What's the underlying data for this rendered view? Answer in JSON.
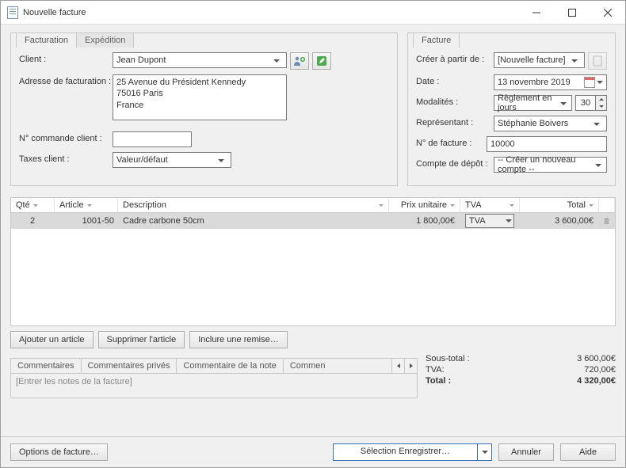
{
  "window": {
    "title": "Nouvelle facture"
  },
  "tabs_left": {
    "billing": "Facturation",
    "shipping": "Expédition"
  },
  "client": {
    "label": "Client :",
    "value": "Jean Dupont",
    "addr_label": "Adresse de facturation :",
    "addr_value": "25 Avenue du Président Kennedy\n75016 Paris\nFrance",
    "order_no_label": "N° commande client :",
    "order_no_value": "",
    "tax_label": "Taxes client :",
    "tax_value": "Valeur/défaut"
  },
  "tabs_right": {
    "invoice": "Facture"
  },
  "invoice": {
    "create_from_label": "Créer à partir de :",
    "create_from_value": "[Nouvelle facture]",
    "date_label": "Date :",
    "date_value": "13 novembre  2019",
    "terms_label": "Modalités :",
    "terms_value": "Règlement en jours",
    "terms_days": "30",
    "rep_label": "Représentant :",
    "rep_value": "Stéphanie Boivers",
    "number_label": "N° de facture :",
    "number_value": "10000",
    "account_label": "Compte de dépôt :",
    "account_value": "-- Créer un nouveau compte --"
  },
  "grid": {
    "headers": {
      "qty": "Qté",
      "article": "Article",
      "desc": "Description",
      "unit": "Prix unitaire",
      "tva": "TVA",
      "total": "Total"
    },
    "rows": [
      {
        "qty": "2",
        "article": "1001-50",
        "desc": "Cadre carbone 50cm",
        "unit": "1 800,00€",
        "tva": "TVA",
        "total": "3 600,00€"
      }
    ]
  },
  "grid_buttons": {
    "add": "Ajouter un article",
    "del": "Supprimer l'article",
    "discount": "Inclure une remise…"
  },
  "comment_tabs": [
    "Commentaires",
    "Commentaires privés",
    "Commentaire de la note",
    "Commen"
  ],
  "notes_placeholder": "[Entrer les notes de la facture]",
  "totals": {
    "subtotal_label": "Sous-total :",
    "subtotal_value": "3 600,00€",
    "tva_label": "TVA:",
    "tva_value": "720,00€",
    "total_label": "Total :",
    "total_value": "4 320,00€"
  },
  "bottom": {
    "options": "Options de facture…",
    "save": "Sélection Enregistrer…",
    "cancel": "Annuler",
    "help": "Aide"
  }
}
